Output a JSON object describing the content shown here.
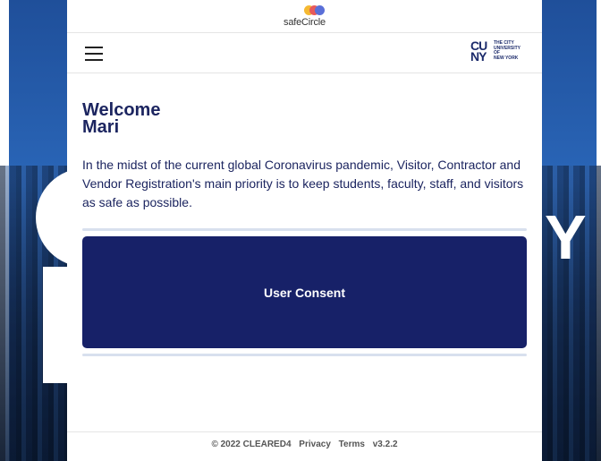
{
  "brand": {
    "safecircle_text": "safeCircle",
    "safecircle_colors": [
      "#f5b932",
      "#e85a5a",
      "#5a6fd8"
    ],
    "cuny_letters_1": "CU",
    "cuny_letters_2": "NY",
    "cuny_tagline": [
      "THE CITY",
      "UNIVERSITY",
      "OF",
      "NEW YORK"
    ]
  },
  "background": {
    "big_letter": "Y"
  },
  "welcome": {
    "heading": "Welcome",
    "name": "Mari"
  },
  "intro_text": "In the midst of the current global Coronavirus pandemic, Visitor, Contractor and Vendor Registration's main priority is to keep students, faculty, staff, and visitors as safe as possible.",
  "consent_button_label": "User Consent",
  "footer": {
    "copyright": "© 2022 CLEARED4",
    "privacy": "Privacy",
    "terms": "Terms",
    "version": "v3.2.2"
  },
  "colors": {
    "primary": "#172168",
    "text": "#1c2560"
  },
  "icons": {
    "menu": "hamburger-menu-icon"
  }
}
